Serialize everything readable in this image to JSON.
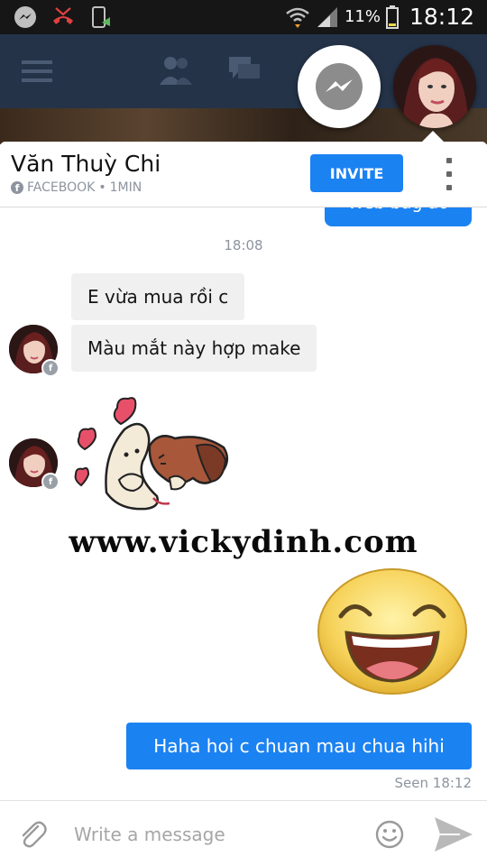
{
  "status_bar": {
    "battery_percent": "11%",
    "time": "18:12",
    "icons": [
      "messenger-icon",
      "missed-call-icon",
      "screen-rotate-icon",
      "wifi-icon",
      "signal-icon",
      "battery-icon"
    ]
  },
  "facebook_bar": {
    "icons": [
      "menu-icon",
      "friends-icon",
      "messages-icon"
    ]
  },
  "chat_header": {
    "contact_name": "Văn Thuỳ Chi",
    "source": "FACEBOOK",
    "separator": "•",
    "time_ago": "1MIN",
    "invite_label": "INVITE"
  },
  "thread": {
    "peek_message": "Web bag ao",
    "timestamp": "18:08",
    "incoming": [
      {
        "text": "E vừa mua rồi c"
      },
      {
        "text": "Màu mắt này hợp make"
      }
    ],
    "watermark": "www.vickydinh.com",
    "outgoing": {
      "text": "Haha hoi c chuan mau chua hihi"
    },
    "seen": "Seen 18:12"
  },
  "composer": {
    "placeholder": "Write a message"
  },
  "colors": {
    "accent": "#1b82f2",
    "fb_bar": "#243348",
    "incoming_bubble": "#f1f0f0",
    "muted_text": "#8d949e"
  }
}
